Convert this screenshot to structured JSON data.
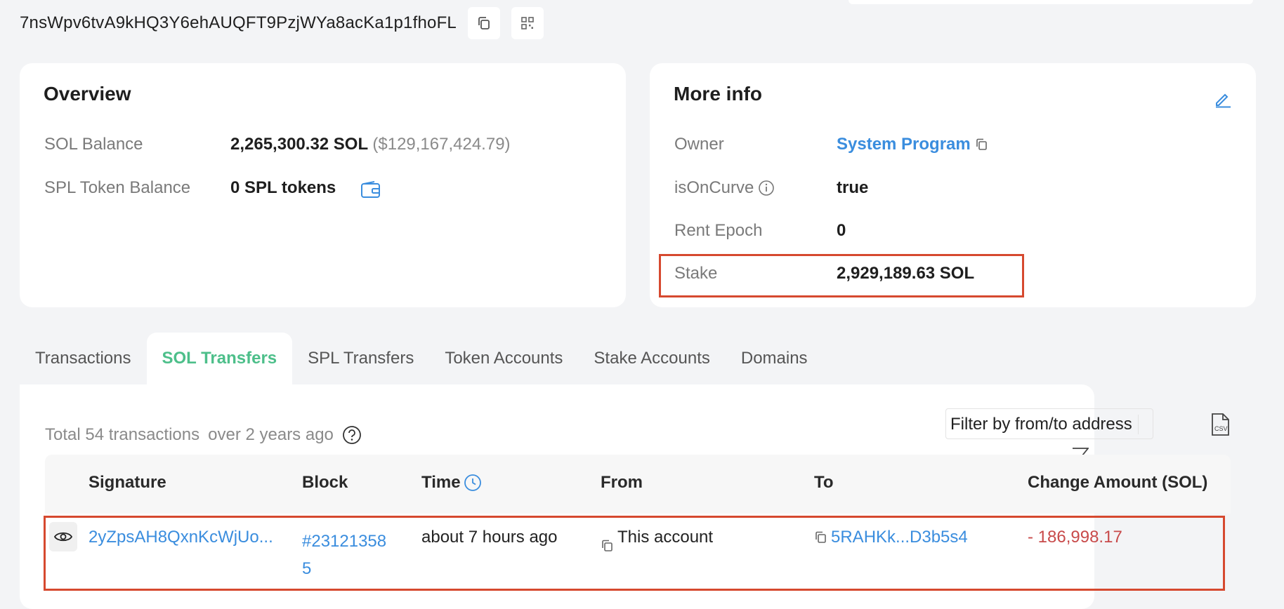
{
  "address": "7nsWpv6tvA9kHQ3Y6ehAUQFT9PzjWYa8acKa1p1fhoFL",
  "overview": {
    "title": "Overview",
    "sol_balance_label": "SOL Balance",
    "sol_balance_value": "2,265,300.32 SOL",
    "sol_balance_usd": "($129,167,424.79)",
    "spl_label": "SPL Token Balance",
    "spl_value": "0 SPL tokens"
  },
  "more_info": {
    "title": "More info",
    "owner_label": "Owner",
    "owner_value": "System Program",
    "oncurve_label": "isOnCurve",
    "oncurve_value": "true",
    "rent_label": "Rent Epoch",
    "rent_value": "0",
    "stake_label": "Stake",
    "stake_value": "2,929,189.63 SOL"
  },
  "tabs": [
    {
      "label": "Transactions"
    },
    {
      "label": "SOL Transfers"
    },
    {
      "label": "SPL Transfers"
    },
    {
      "label": "Token Accounts"
    },
    {
      "label": "Stake Accounts"
    },
    {
      "label": "Domains"
    }
  ],
  "table": {
    "total_text": "Total 54 transactions",
    "age_text": "over 2 years ago",
    "filter_placeholder": "Filter by from/to address",
    "headers": [
      "Signature",
      "Block",
      "Time",
      "From",
      "To",
      "Change Amount (SOL)"
    ],
    "rows": [
      {
        "signature": "2yZpsAH8QxnKcWjUo...",
        "block_line1": "#23121358",
        "block_line2": "5",
        "time": "about 7 hours ago",
        "from": "This account",
        "to": "5RAHKk...D3b5s4",
        "amount_sign": "- ",
        "amount": "186,998.17"
      }
    ]
  },
  "colors": {
    "accent": "#4dbf8a",
    "link": "#3a8dde",
    "highlight": "#d6492f",
    "negative": "#c84a4a"
  }
}
